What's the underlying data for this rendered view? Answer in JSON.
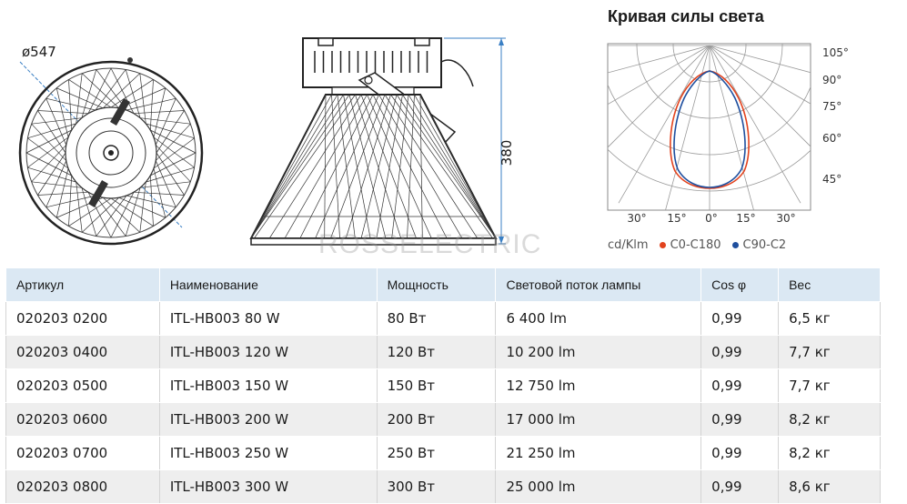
{
  "dimensions": {
    "diameter": "ø547",
    "height": "380"
  },
  "polar": {
    "title": "Кривая силы света",
    "angle_labels_right": [
      "105°",
      "90°",
      "75°",
      "60°",
      "45°"
    ],
    "angle_labels_bottom": [
      "30°",
      "15°",
      "0°",
      "15°",
      "30°"
    ],
    "unit": "cd/Klm",
    "curves": [
      {
        "name": "C0-C180",
        "color": "#e2431e"
      },
      {
        "name": "C90-C2",
        "color": "#1f4f9e"
      }
    ]
  },
  "watermark": "ROSSELECTRIC",
  "table": {
    "headers": [
      "Артикул",
      "Наименование",
      "Мощность",
      "Световой поток лампы",
      "Cos φ",
      "Вес"
    ],
    "rows": [
      [
        "020203 0200",
        "ITL-HB003 80 W",
        "80 Вт",
        "6 400 lm",
        "0,99",
        "6,5 кг"
      ],
      [
        "020203 0400",
        "ITL-HB003 120 W",
        "120 Вт",
        "10 200 lm",
        "0,99",
        "7,7 кг"
      ],
      [
        "020203 0500",
        "ITL-HB003 150 W",
        "150 Вт",
        "12 750 lm",
        "0,99",
        "7,7 кг"
      ],
      [
        "020203 0600",
        "ITL-HB003 200 W",
        "200 Вт",
        "17 000 lm",
        "0,99",
        "8,2 кг"
      ],
      [
        "020203 0700",
        "ITL-HB003 250 W",
        "250 Вт",
        "21 250 lm",
        "0,99",
        "8,2 кг"
      ],
      [
        "020203 0800",
        "ITL-HB003 300 W",
        "300 Вт",
        "25 000 lm",
        "0,99",
        "8,6 кг"
      ]
    ]
  }
}
